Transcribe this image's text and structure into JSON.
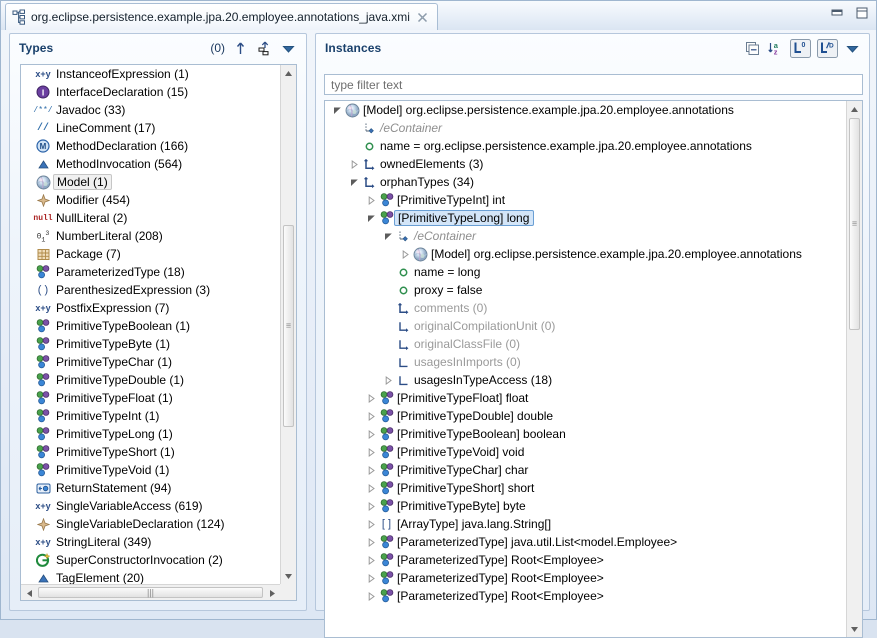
{
  "window": {
    "tab_title": "org.eclipse.persistence.example.jpa.20.employee.annotations_java.xmi",
    "tab_icon": "xmi-model-icon",
    "close_icon": "close-icon",
    "minimize_icon": "minimize-icon",
    "maximize_icon": "maximize-icon"
  },
  "types_panel": {
    "title": "Types",
    "count": "(0)",
    "tools": [
      {
        "name": "collapse-up-icon",
        "title": "up"
      },
      {
        "name": "sort-hierarchy-icon",
        "title": "hierarchy"
      },
      {
        "name": "view-menu-icon",
        "title": "menu"
      }
    ],
    "items": [
      {
        "icon": "xy-expression-icon",
        "label": "InstanceofExpression (1)",
        "selected": false
      },
      {
        "icon": "interface-icon",
        "label": "InterfaceDeclaration (15)",
        "selected": false
      },
      {
        "icon": "javadoc-icon",
        "label": "Javadoc (33)",
        "selected": false
      },
      {
        "icon": "linecomment-icon",
        "label": "LineComment (17)",
        "selected": false
      },
      {
        "icon": "method-icon",
        "label": "MethodDeclaration (166)",
        "selected": false
      },
      {
        "icon": "invocation-icon",
        "label": "MethodInvocation (564)",
        "selected": false
      },
      {
        "icon": "model-icon",
        "label": "Model (1)",
        "selected": true
      },
      {
        "icon": "modifier-icon",
        "label": "Modifier (454)",
        "selected": false
      },
      {
        "icon": "null-literal-icon",
        "label": "NullLiteral (2)",
        "selected": false
      },
      {
        "icon": "number-literal-icon",
        "label": "NumberLiteral (208)",
        "selected": false
      },
      {
        "icon": "package-icon",
        "label": "Package (7)",
        "selected": false
      },
      {
        "icon": "type-icon",
        "label": "ParameterizedType (18)",
        "selected": false
      },
      {
        "icon": "paren-icon",
        "label": "ParenthesizedExpression (3)",
        "selected": false
      },
      {
        "icon": "xy-expression-icon",
        "label": "PostfixExpression (7)",
        "selected": false
      },
      {
        "icon": "type-icon",
        "label": "PrimitiveTypeBoolean (1)",
        "selected": false
      },
      {
        "icon": "type-icon",
        "label": "PrimitiveTypeByte (1)",
        "selected": false
      },
      {
        "icon": "type-icon",
        "label": "PrimitiveTypeChar (1)",
        "selected": false
      },
      {
        "icon": "type-icon",
        "label": "PrimitiveTypeDouble (1)",
        "selected": false
      },
      {
        "icon": "type-icon",
        "label": "PrimitiveTypeFloat (1)",
        "selected": false
      },
      {
        "icon": "type-icon",
        "label": "PrimitiveTypeInt (1)",
        "selected": false
      },
      {
        "icon": "type-icon",
        "label": "PrimitiveTypeLong (1)",
        "selected": false
      },
      {
        "icon": "type-icon",
        "label": "PrimitiveTypeShort (1)",
        "selected": false
      },
      {
        "icon": "type-icon",
        "label": "PrimitiveTypeVoid (1)",
        "selected": false
      },
      {
        "icon": "return-statement-icon",
        "label": "ReturnStatement (94)",
        "selected": false
      },
      {
        "icon": "xy-expression-icon",
        "label": "SingleVariableAccess (619)",
        "selected": false
      },
      {
        "icon": "modifier-icon",
        "label": "SingleVariableDeclaration (124)",
        "selected": false
      },
      {
        "icon": "xy-expression-icon",
        "label": "StringLiteral (349)",
        "selected": false
      },
      {
        "icon": "super-constructor-icon",
        "label": "SuperConstructorInvocation (2)",
        "selected": false
      },
      {
        "icon": "invocation-icon",
        "label": "TagElement (20)",
        "selected": false
      }
    ]
  },
  "instances_panel": {
    "title": "Instances",
    "tools": [
      {
        "name": "collapse-all-icon"
      },
      {
        "name": "sort-az-icon"
      },
      {
        "name": "show-label-icon"
      },
      {
        "name": "show-derived-icon"
      },
      {
        "name": "view-menu-icon"
      }
    ],
    "filter": {
      "placeholder": "type filter text",
      "value": ""
    },
    "tree": [
      {
        "indent": 0,
        "twisty": "expanded",
        "icon": "model-icon",
        "label": "[Model] org.eclipse.persistence.example.jpa.20.employee.annotations",
        "style": "normal",
        "selected": false
      },
      {
        "indent": 1,
        "twisty": "none",
        "icon": "econtainer-icon",
        "label": "/eContainer",
        "style": "italic",
        "selected": false
      },
      {
        "indent": 1,
        "twisty": "none",
        "icon": "attribute-icon",
        "label": "name = org.eclipse.persistence.example.jpa.20.employee.annotations",
        "style": "normal",
        "selected": false
      },
      {
        "indent": 1,
        "twisty": "collapsed",
        "icon": "containment-icon",
        "label": "ownedElements (3)",
        "style": "normal",
        "selected": false
      },
      {
        "indent": 1,
        "twisty": "expanded",
        "icon": "containment-icon",
        "label": "orphanTypes (34)",
        "style": "normal",
        "selected": false
      },
      {
        "indent": 2,
        "twisty": "collapsed",
        "icon": "type-icon",
        "label": "[PrimitiveTypeInt] int",
        "style": "normal",
        "selected": false
      },
      {
        "indent": 2,
        "twisty": "expanded",
        "icon": "type-icon",
        "label": "[PrimitiveTypeLong] long",
        "style": "normal",
        "selected": true
      },
      {
        "indent": 3,
        "twisty": "expanded",
        "icon": "econtainer-icon",
        "label": "/eContainer",
        "style": "italic",
        "selected": false
      },
      {
        "indent": 4,
        "twisty": "collapsed",
        "icon": "model-icon",
        "label": "[Model] org.eclipse.persistence.example.jpa.20.employee.annotations",
        "style": "normal",
        "selected": false
      },
      {
        "indent": 3,
        "twisty": "none",
        "icon": "attribute-icon",
        "label": "name = long",
        "style": "normal",
        "selected": false
      },
      {
        "indent": 3,
        "twisty": "none",
        "icon": "attribute-icon",
        "label": "proxy = false",
        "style": "normal",
        "selected": false
      },
      {
        "indent": 3,
        "twisty": "none",
        "icon": "containment-icon",
        "label": "comments (0)",
        "style": "grey",
        "selected": false
      },
      {
        "indent": 3,
        "twisty": "none",
        "icon": "reference-icon",
        "label": "originalCompilationUnit (0)",
        "style": "grey",
        "selected": false
      },
      {
        "indent": 3,
        "twisty": "none",
        "icon": "reference-icon",
        "label": "originalClassFile (0)",
        "style": "grey",
        "selected": false
      },
      {
        "indent": 3,
        "twisty": "none",
        "icon": "reference-plain-icon",
        "label": "usagesInImports (0)",
        "style": "grey",
        "selected": false
      },
      {
        "indent": 3,
        "twisty": "collapsed",
        "icon": "reference-plain-icon",
        "label": "usagesInTypeAccess (18)",
        "style": "normal",
        "selected": false
      },
      {
        "indent": 2,
        "twisty": "collapsed",
        "icon": "type-icon",
        "label": "[PrimitiveTypeFloat] float",
        "style": "normal",
        "selected": false
      },
      {
        "indent": 2,
        "twisty": "collapsed",
        "icon": "type-icon",
        "label": "[PrimitiveTypeDouble] double",
        "style": "normal",
        "selected": false
      },
      {
        "indent": 2,
        "twisty": "collapsed",
        "icon": "type-icon",
        "label": "[PrimitiveTypeBoolean] boolean",
        "style": "normal",
        "selected": false
      },
      {
        "indent": 2,
        "twisty": "collapsed",
        "icon": "type-icon",
        "label": "[PrimitiveTypeVoid] void",
        "style": "normal",
        "selected": false
      },
      {
        "indent": 2,
        "twisty": "collapsed",
        "icon": "type-icon",
        "label": "[PrimitiveTypeChar] char",
        "style": "normal",
        "selected": false
      },
      {
        "indent": 2,
        "twisty": "collapsed",
        "icon": "type-icon",
        "label": "[PrimitiveTypeShort] short",
        "style": "normal",
        "selected": false
      },
      {
        "indent": 2,
        "twisty": "collapsed",
        "icon": "type-icon",
        "label": "[PrimitiveTypeByte] byte",
        "style": "normal",
        "selected": false
      },
      {
        "indent": 2,
        "twisty": "collapsed",
        "icon": "array-type-icon",
        "label": "[ArrayType] java.lang.String[]",
        "style": "normal",
        "selected": false
      },
      {
        "indent": 2,
        "twisty": "collapsed",
        "icon": "type-icon",
        "label": "[ParameterizedType] java.util.List<model.Employee>",
        "style": "normal",
        "selected": false
      },
      {
        "indent": 2,
        "twisty": "collapsed",
        "icon": "type-icon",
        "label": "[ParameterizedType] Root<Employee>",
        "style": "normal",
        "selected": false
      },
      {
        "indent": 2,
        "twisty": "collapsed",
        "icon": "type-icon",
        "label": "[ParameterizedType] Root<Employee>",
        "style": "normal",
        "selected": false
      },
      {
        "indent": 2,
        "twisty": "collapsed",
        "icon": "type-icon",
        "label": "[ParameterizedType] Root<Employee>",
        "style": "normal",
        "selected": false
      }
    ]
  },
  "colors": {
    "panel_title": "#19406b",
    "selection_fill": "#d3e5f8",
    "selection_border": "#6a9fd4",
    "tree_background": "#ffffff",
    "disabled_text": "#9a9a9a"
  }
}
